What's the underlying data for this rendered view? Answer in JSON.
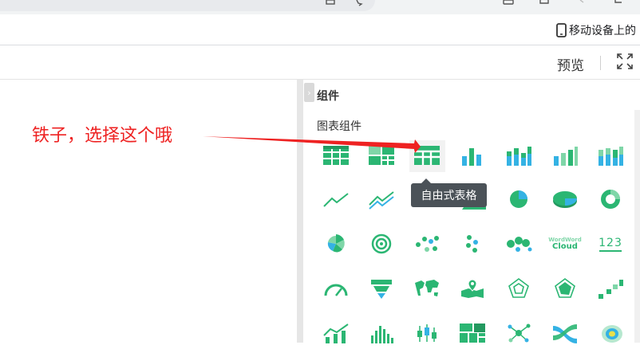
{
  "browser": {
    "bookmark": {
      "icon": "phone-icon",
      "label": "移动设备上的"
    }
  },
  "toolbar": {
    "preview_label": "预览",
    "fullscreen_icon": "fullscreen-icon"
  },
  "panel": {
    "title": "组件",
    "collapse_icon": "chevron-right-icon",
    "section_title": "图表组件",
    "tooltip": "自由式表格",
    "accent_color": "#2bb673",
    "secondary_color": "#34b2e4"
  },
  "annotation": {
    "text": "铁子，选择这个哦",
    "color": "#ee2222"
  },
  "components": [
    [
      "table-icon",
      "cross-table-icon",
      "freeform-table-icon",
      "bar-chart-icon",
      "stacked-bar-icon",
      "bar-3d-icon",
      "stacked-bar-3d-icon"
    ],
    [
      "line-chart-icon",
      "multi-line-chart-icon",
      "area-chart-icon",
      "area-stack-icon",
      "pie-chart-icon",
      "pie-3d-icon",
      "donut-chart-icon"
    ],
    [
      "rose-chart-icon",
      "ring-progress-icon",
      "scatter-chart-icon",
      "dot-chart-icon",
      "bubble-chart-icon",
      "word-cloud-icon",
      "number-card-icon"
    ],
    [
      "gauge-icon",
      "funnel-icon",
      "world-map-icon",
      "location-map-icon",
      "radar-chart-icon",
      "filled-radar-icon",
      "step-bar-icon"
    ],
    [
      "bar-line-combo-icon",
      "histogram-icon",
      "candlestick-icon",
      "treemap-icon",
      "network-graph-icon",
      "sankey-icon",
      "heatmap-icon"
    ]
  ],
  "word_cloud_labels": {
    "top": "WordWord",
    "bottom": "Cloud"
  },
  "number_card_label": "123"
}
